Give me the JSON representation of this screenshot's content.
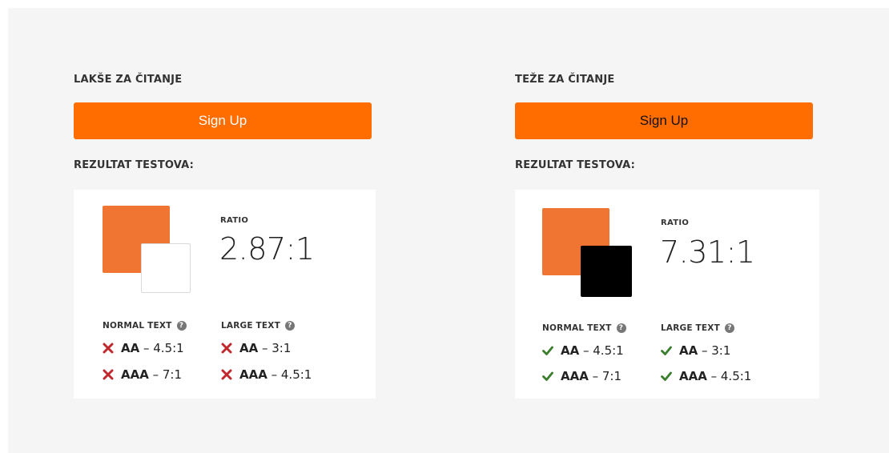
{
  "colors": {
    "accent": "#ff6c00",
    "swatch_bg": "#f07533",
    "fail": "#c0282d",
    "pass": "#3a7d2c"
  },
  "left": {
    "heading": "LAKŠE ZA ČITANJE",
    "button_label": "Sign Up",
    "button_text_color": "#ffffff",
    "results_heading": "REZULTAT TESTOVA:",
    "ratio_label": "RATIO",
    "ratio_value": "2.87:1",
    "foreground_color": "#ffffff",
    "normal_label": "NORMAL TEXT",
    "large_label": "LARGE TEXT",
    "normal": [
      {
        "level": "AA",
        "target": "– 4.5:1",
        "result": "fail",
        "icon": "cross-icon"
      },
      {
        "level": "AAA",
        "target": "– 7:1",
        "result": "fail",
        "icon": "cross-icon"
      }
    ],
    "large": [
      {
        "level": "AA",
        "target": "– 3:1",
        "result": "fail",
        "icon": "cross-icon"
      },
      {
        "level": "AAA",
        "target": "– 4.5:1",
        "result": "fail",
        "icon": "cross-icon"
      }
    ]
  },
  "right": {
    "heading": "TEŽE ZA ČITANJE",
    "button_label": "Sign Up",
    "button_text_color": "#111111",
    "results_heading": "REZULTAT TESTOVA:",
    "ratio_label": "RATIO",
    "ratio_value": "7.31:1",
    "foreground_color": "#000000",
    "normal_label": "NORMAL TEXT",
    "large_label": "LARGE TEXT",
    "normal": [
      {
        "level": "AA",
        "target": "– 4.5:1",
        "result": "pass",
        "icon": "check-icon"
      },
      {
        "level": "AAA",
        "target": "– 7:1",
        "result": "pass",
        "icon": "check-icon"
      }
    ],
    "large": [
      {
        "level": "AA",
        "target": "– 3:1",
        "result": "pass",
        "icon": "check-icon"
      },
      {
        "level": "AAA",
        "target": "– 4.5:1",
        "result": "pass",
        "icon": "check-icon"
      }
    ]
  }
}
